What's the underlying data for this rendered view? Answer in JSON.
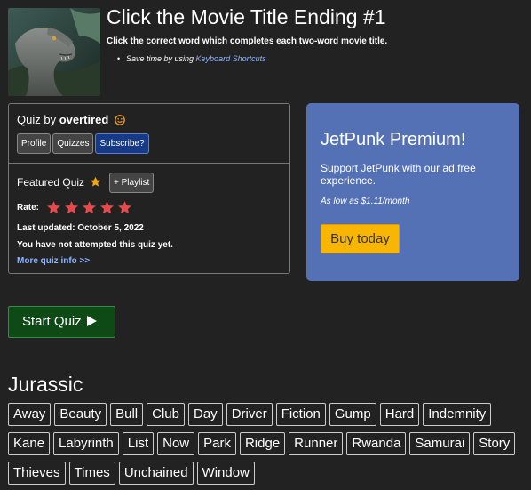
{
  "header": {
    "title": "Click the Movie Title Ending #1",
    "subtitle": "Click the correct word which completes each two-word movie title.",
    "shortcut_prefix": "Save time by using ",
    "shortcut_link": "Keyboard Shortcuts"
  },
  "info": {
    "quiz_by_label": "Quiz by ",
    "author": "overtired",
    "buttons": {
      "profile": "Profile",
      "quizzes": "Quizzes",
      "subscribe": "Subscribe?"
    },
    "featured_label": "Featured Quiz",
    "playlist_button": "+ Playlist",
    "rate_label": "Rate:",
    "rating_stars": 5,
    "last_updated": "Last updated: October 5, 2022",
    "attempt_status": "You have not attempted this quiz yet.",
    "more_info_link": "More quiz info >>"
  },
  "premium": {
    "title": "JetPunk Premium!",
    "text": "Support JetPunk with our ad free experience.",
    "price": "As low as $1.11/month",
    "buy_button": "Buy today"
  },
  "start_button": "Start Quiz",
  "quiz": {
    "prefix": "Jurassic",
    "words": [
      "Away",
      "Beauty",
      "Bull",
      "Club",
      "Day",
      "Driver",
      "Fiction",
      "Gump",
      "Hard",
      "Indemnity",
      "Kane",
      "Labyrinth",
      "List",
      "Now",
      "Park",
      "Ridge",
      "Runner",
      "Rwanda",
      "Samurai",
      "Story",
      "Thieves",
      "Times",
      "Unchained",
      "Window"
    ]
  },
  "colors": {
    "background": "#222222",
    "link": "#8fb4ff",
    "premium_bg": "#5571b6",
    "buy_button": "#f8b600",
    "start_button": "#0e4a15",
    "star": "#e8474c",
    "smiley": "#f0a020"
  },
  "icons": {
    "smiley": "smiley-icon",
    "featured_star": "gold-star-icon",
    "rate_star": "star-icon",
    "play": "play-icon"
  }
}
